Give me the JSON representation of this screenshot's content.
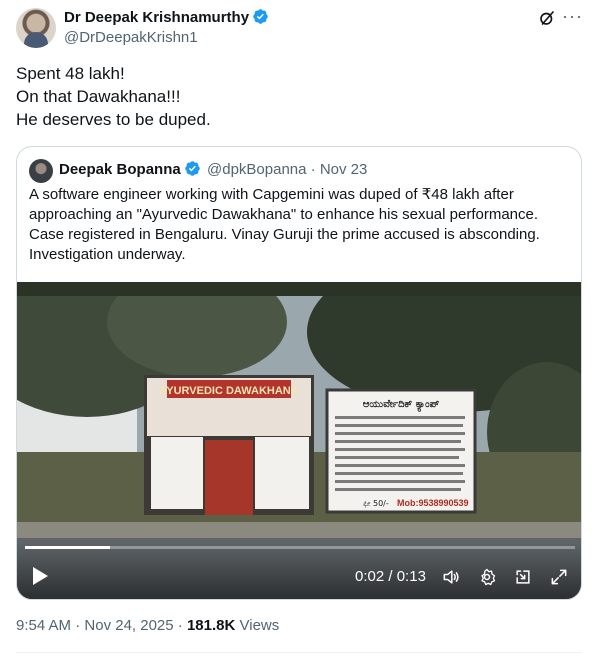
{
  "author": {
    "name": "Dr Deepak Krishnamurthy",
    "handle": "@DrDeepakKrishn1"
  },
  "tweet": {
    "lines": [
      "Spent 48 lakh!",
      "On that Dawakhana!!!",
      "He deserves to be duped."
    ]
  },
  "quoted": {
    "name": "Deepak Bopanna",
    "handle": "@dpkBopanna",
    "separator": "·",
    "date": "Nov 23",
    "lines": [
      "A software engineer working with Capgemini was duped of ₹48 lakh after",
      "approaching an \"Ayurvedic Dawakhana\" to enhance his sexual performance.",
      "Case registered in Bengaluru. Vinay Guruji the prime accused is absconding.",
      "Investigation underway."
    ],
    "video": {
      "sign_left_title": "AYURVEDIC DAWAKHANA",
      "sign_right_title": "ಆಯುರ್ವೇದಿಕ್ ಕ್ಯಾಂಪ್",
      "sign_right_phone": "Mob:9538990539",
      "sign_right_fee": "ಫೀ 50/-",
      "time_current": "0:02",
      "time_sep": " / ",
      "time_total": "0:13",
      "progress": 0.154
    }
  },
  "footer": {
    "time": "9:54 AM",
    "dot1": "·",
    "date": "Nov 24, 2025",
    "dot2": "·",
    "views_count": "181.8K",
    "views_label": "Views"
  },
  "colors": {
    "text": "#0f1419",
    "secondary": "#536471",
    "verified": "#1d9bf0",
    "border": "#cfd9de"
  },
  "icons": [
    "verified-badge-icon",
    "grok-icon",
    "more-icon",
    "play-icon",
    "volume-icon",
    "settings-icon",
    "minimize-icon",
    "fullscreen-icon"
  ]
}
